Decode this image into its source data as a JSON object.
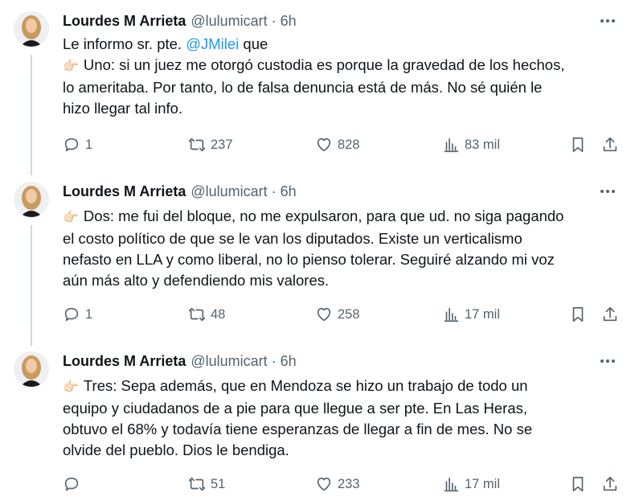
{
  "tweets": [
    {
      "name": "Lourdes M Arrieta",
      "handle": "@lulumicart",
      "sep": "·",
      "time": "6h",
      "lines": [
        {
          "pre": "Le informo sr. pte. ",
          "mention": "@JMilei",
          "post": " que"
        },
        {
          "emoji": "👉🏻",
          "text": "Uno: si un juez me otorgó custodia es porque la gravedad de los hechos,"
        },
        {
          "text": "lo ameritaba. Por tanto, lo de falsa denuncia está de más. No sé quién le"
        },
        {
          "text": "hizo llegar tal info."
        }
      ],
      "replies": "1",
      "retweets": "237",
      "likes": "828",
      "views": "83 mil"
    },
    {
      "name": "Lourdes M Arrieta",
      "handle": "@lulumicart",
      "sep": "·",
      "time": "6h",
      "lines": [
        {
          "emoji": "👉🏻",
          "text": "Dos: me fui del bloque, no me expulsaron, para que ud. no siga pagando"
        },
        {
          "text": "el costo político de que se le van los diputados. Existe un verticalismo"
        },
        {
          "text": "nefasto en LLA y como liberal, no lo pienso tolerar. Seguiré alzando mi voz"
        },
        {
          "text": "aún más alto y defendiendo mis valores."
        }
      ],
      "replies": "1",
      "retweets": "48",
      "likes": "258",
      "views": "17 mil"
    },
    {
      "name": "Lourdes M Arrieta",
      "handle": "@lulumicart",
      "sep": "·",
      "time": "6h",
      "lines": [
        {
          "emoji": "👉🏻",
          "text": "Tres: Sepa además, que en Mendoza se hizo un trabajo de todo un"
        },
        {
          "text": "equipo y ciudadanos de a pie para que llegue a ser pte. En Las Heras,"
        },
        {
          "text": "obtuvo el 68% y todavía tiene esperanzas de llegar a fin de mes. No se"
        },
        {
          "text": "olvide del pueblo. Dios le bendiga."
        }
      ],
      "replies": "",
      "retweets": "51",
      "likes": "233",
      "views": "17 mil"
    }
  ],
  "icons": {
    "reply": "reply-icon",
    "retweet": "retweet-icon",
    "like": "heart-icon",
    "views": "views-icon",
    "bookmark": "bookmark-icon",
    "share": "share-icon",
    "more": "more-icon",
    "pointing": "pointing-hand-icon"
  },
  "colors": {
    "mention": "#1d9bf0",
    "secondary": "#536471",
    "thread_line": "#cfd9de"
  }
}
